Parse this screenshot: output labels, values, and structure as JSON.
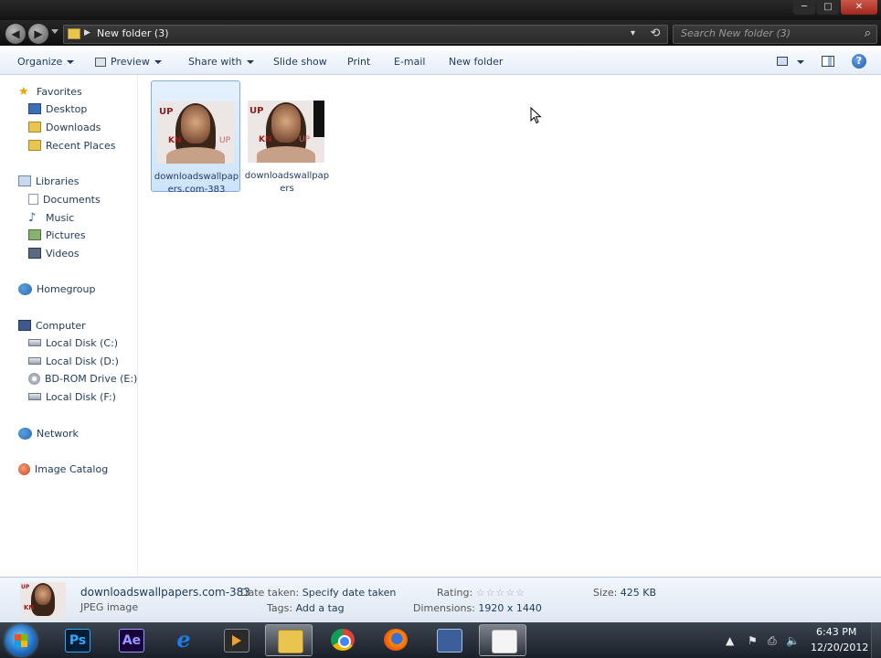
{
  "window": {
    "minimize_glyph": "─",
    "maximize_glyph": "□",
    "close_glyph": "✕"
  },
  "address": {
    "path": "New folder (3)",
    "separator": "▶",
    "back_glyph": "◀",
    "forward_glyph": "▶",
    "search_placeholder": "Search New folder (3)",
    "search_glyph": "⌕",
    "refresh_glyph": "⟲",
    "dropdown_glyph": "▾"
  },
  "toolbar": {
    "organize": "Organize",
    "preview": "Preview",
    "share_with": "Share with",
    "slide_show": "Slide show",
    "print": "Print",
    "email": "E-mail",
    "new_folder": "New folder",
    "help_glyph": "?"
  },
  "nav": {
    "favorites": "Favorites",
    "desktop": "Desktop",
    "downloads": "Downloads",
    "recent_places": "Recent Places",
    "libraries": "Libraries",
    "documents": "Documents",
    "music": "Music",
    "pictures": "Pictures",
    "videos": "Videos",
    "homegroup": "Homegroup",
    "computer": "Computer",
    "local_c": "Local Disk (C:)",
    "local_d": "Local Disk (D:)",
    "bd_rom": "BD-ROM Drive (E:) F",
    "local_f": "Local Disk (F:)",
    "network": "Network",
    "image_catalog": "Image Catalog",
    "star_glyph": "★",
    "music_glyph": "♪"
  },
  "files": [
    {
      "name": "downloadswallpapers.com-383",
      "selected": true
    },
    {
      "name": "downloadswallpapers",
      "selected": false
    }
  ],
  "thumb_text": {
    "up": "UP",
    "kn": "KN",
    "up2": "UP"
  },
  "details": {
    "name": "downloadswallpapers.com-383",
    "type": "JPEG image",
    "date_taken_label": "Date taken:",
    "date_taken_value": "Specify date taken",
    "tags_label": "Tags:",
    "tags_value": "Add a tag",
    "rating_label": "Rating:",
    "rating_stars": "☆☆☆☆☆",
    "dimensions_label": "Dimensions:",
    "dimensions_value": "1920 x 1440",
    "size_label": "Size:",
    "size_value": "425 KB"
  },
  "taskbar": {
    "ps": "Ps",
    "ae": "Ae",
    "ie": "e",
    "tray_up": "▲",
    "tray_flag": "⚑",
    "tray_network": "⎙",
    "tray_volume": "🔈",
    "time": "6:43 PM",
    "date": "12/20/2012"
  }
}
